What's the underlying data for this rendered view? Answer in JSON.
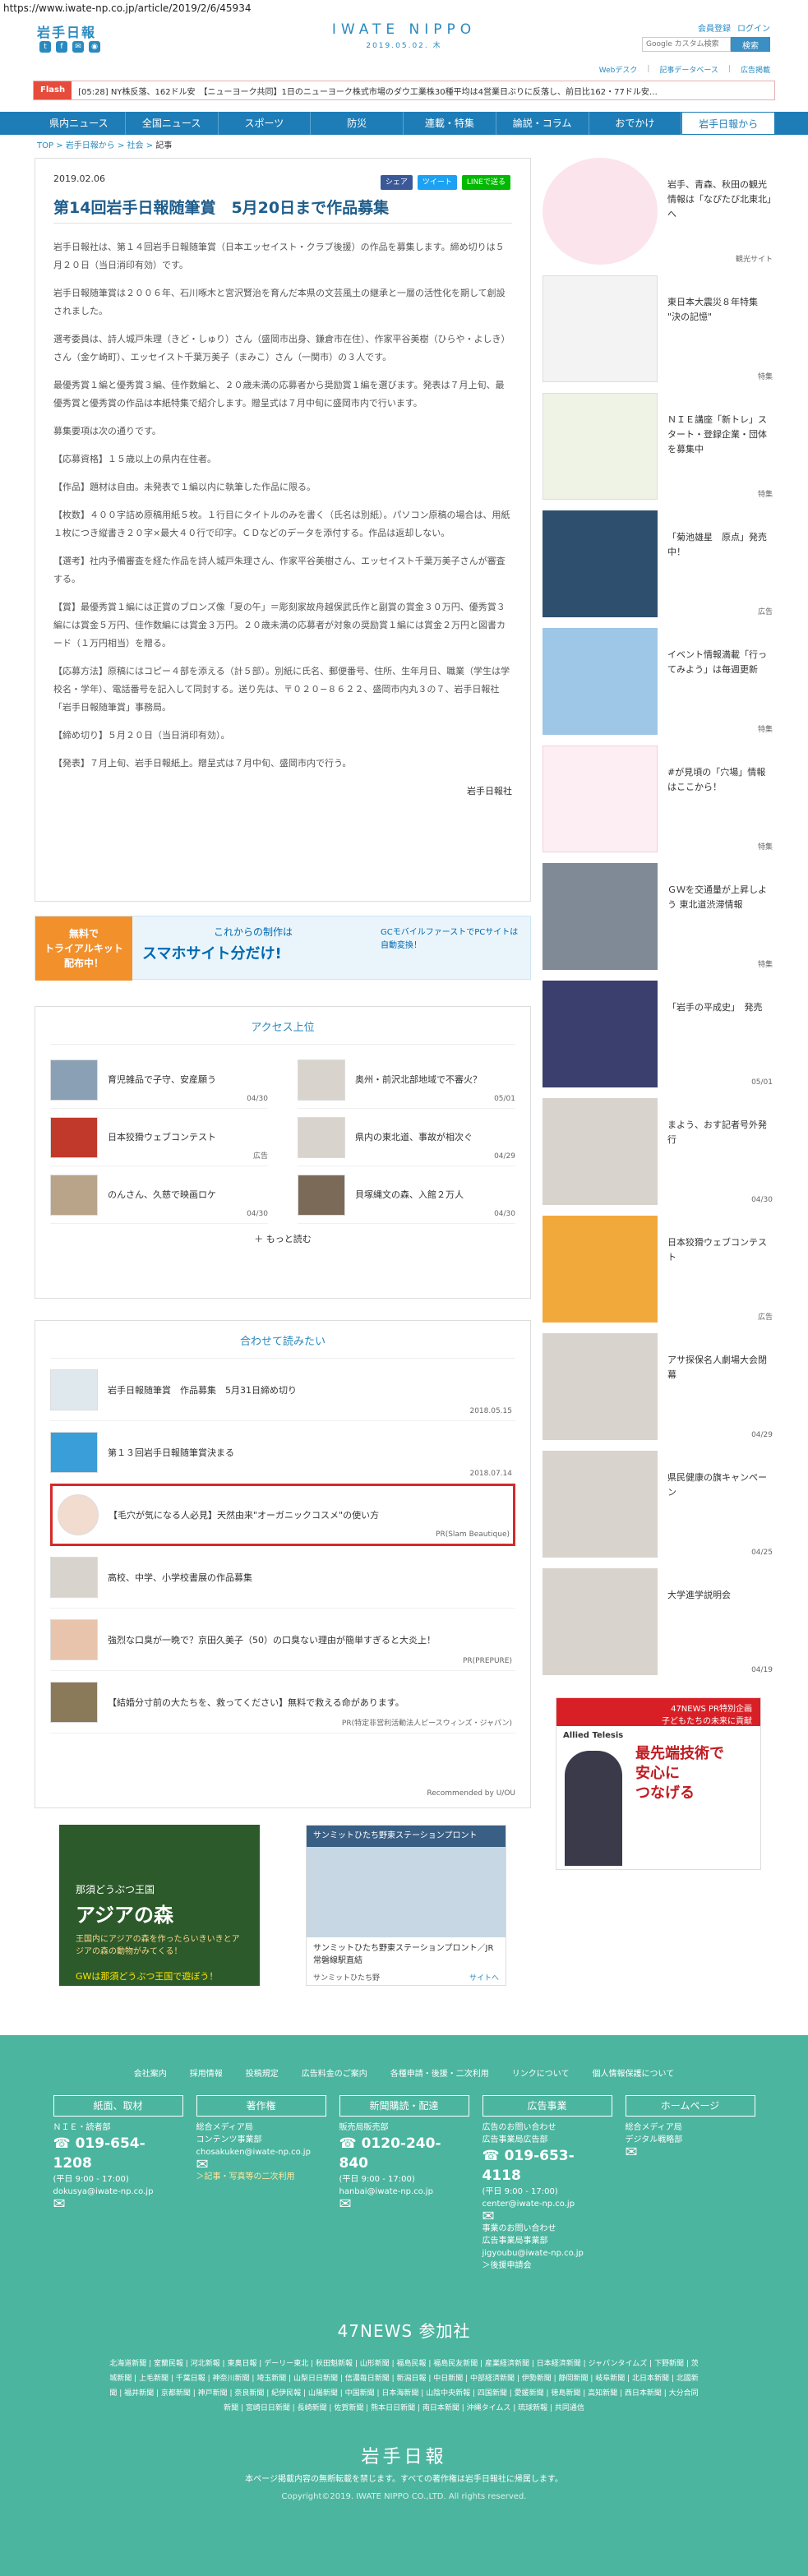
{
  "url": "https://www.iwate-np.co.jp/article/2019/2/6/45934",
  "header": {
    "brand": "岩手日報",
    "logo_main": "IWATE NIPPO",
    "logo_date": "2019.05.02. 木",
    "member_register": "会員登録",
    "login": "ログイン",
    "search_placeholder": "Google カスタム検索",
    "search_button": "検索"
  },
  "subnav": [
    "Webデスク",
    "記事データベース",
    "広告掲載"
  ],
  "flash": {
    "tag": "Flash",
    "text": "[05:28] NY株反落、162ドル安　【ニューヨーク共同】1日のニューヨーク株式市場のダウ工業株30種平均は4営業日ぶりに反落し、前日比162・77ドル安…"
  },
  "global_nav": [
    "県内ニュース",
    "全国ニュース",
    "スポーツ",
    "防災",
    "連載・特集",
    "論説・コラム",
    "おでかけ",
    "岩手日報から"
  ],
  "breadcrumb": [
    "TOP",
    "岩手日報から",
    "社会",
    "記事"
  ],
  "article": {
    "date": "2019.02.06",
    "share": [
      "シェア",
      "ツイート",
      "LINEで送る"
    ],
    "title": "第14回岩手日報随筆賞　5月20日まで作品募集",
    "paragraphs": [
      "岩手日報社は、第１４回岩手日報随筆賞（日本エッセイスト・クラブ後援）の作品を募集します。締め切りは５月２０日（当日消印有効）です。",
      "岩手日報随筆賞は２００６年、石川啄木と宮沢賢治を育んだ本県の文芸風土の継承と一層の活性化を期して創設されました。",
      "選考委員は、詩人城戸朱理（きど・しゅり）さん（盛岡市出身、鎌倉市在住）、作家平谷美樹（ひらや・よしき）さん（金ケ崎町）、エッセイスト千葉万美子（まみこ）さん（一関市）の３人です。",
      "最優秀賞１編と優秀賞３編、佳作数編と、２０歳未満の応募者から奨励賞１編を選びます。発表は７月上旬、最優秀賞と優秀賞の作品は本紙特集で紹介します。贈呈式は７月中旬に盛岡市内で行います。",
      "募集要項は次の通りです。",
      "【応募資格】１５歳以上の県内在住者。",
      "【作品】題材は自由。未発表で１編以内に執筆した作品に限る。",
      "【枚数】４００字詰め原稿用紙５枚。１行目にタイトルのみを書く（氏名は別紙）。パソコン原稿の場合は、用紙１枚につき縦書き２０字×最大４０行で印字。ＣＤなどのデータを添付する。作品は返却しない。",
      "【選考】社内予備審査を経た作品を詩人城戸朱理さん、作家平谷美樹さん、エッセイスト千葉万美子さんが審査する。",
      "【賞】最優秀賞１編には正賞のブロンズ像「夏の午」＝彫刻家故舟越保武氏作と副賞の賞金３０万円、優秀賞３編には賞金５万円、佳作数編には賞金３万円。２０歳未満の応募者が対象の奨励賞１編には賞金２万円と図書カード（１万円相当）を贈る。",
      "【応募方法】原稿にはコピー４部を添える（計５部）。別紙に氏名、郵便番号、住所、生年月日、職業（学生は学校名・学年）、電話番号を記入して同封する。送り先は、〒０２０−８６２２、盛岡市内丸３の７、岩手日報社「岩手日報随筆賞」事務局。",
      "【締め切り】５月２０日（当日消印有効）。",
      "【発表】７月上旬、岩手日報紙上。贈呈式は７月中旬、盛岡市内で行う。"
    ],
    "signature": "岩手日報社"
  },
  "ad_banner": {
    "left": "無料で\nトライアルキット\n配布中！",
    "sub": "これからの制作は",
    "main": "スマホサイト分だけ!",
    "right": "GCモバイルファーストでPCサイトは自動変換！"
  },
  "ranking": {
    "title": "アクセス上位",
    "items": [
      {
        "text": "育児雑品で子守、安産願う",
        "date": "04/30"
      },
      {
        "text": "奥州・前沢北部地域で不審火？",
        "date": "05/01"
      },
      {
        "text": "日本狡猾ウェブコンテスト",
        "date": "広告"
      },
      {
        "text": "県内の東北道、事故が相次ぐ",
        "date": "04/29"
      },
      {
        "text": "のんさん、久慈で映画ロケ",
        "date": "04/30"
      },
      {
        "text": "貝塚縄文の森、入館２万人",
        "date": "04/30"
      }
    ],
    "more": "もっと読む"
  },
  "recommend": {
    "title": "合わせて読みたい",
    "items": [
      {
        "text": "岩手日報随筆賞　作品募集　5月31日締め切り",
        "date": "2018.05.15"
      },
      {
        "text": "第１３回岩手日報随筆賞決まる",
        "date": "2018.07.14"
      },
      {
        "text": "【毛穴が気になる人必見】天然由来\"オーガニックコスメ\"の使い方",
        "date": "PR(Slam Beautique)"
      },
      {
        "text": "高校、中学、小学校書展の作品募集",
        "date": ""
      },
      {
        "text": "強烈な口臭が一晩で？京田久美子（50）の口臭ない理由が簡単すぎると大炎上！",
        "date": "PR(PREPURE)"
      },
      {
        "text": "【結婚分寸前の大たちを、救ってください】無料で救える命があります。",
        "date": "PR(特定非営利活動法人ピースウィンズ・ジャパン)"
      }
    ],
    "footer": "Recommended by U/OU"
  },
  "bottom_ads": {
    "ad1_a": "那須どうぶつ王国",
    "ad1_b": "アジアの森",
    "ad1_c": "王国内にアジアの森を作ったらいきいきとアジアの森の動物がみてくる！",
    "ad1_d": "GWは那須どうぶつ王国で遊ぼう！",
    "ad2_top": "サンミットひたち野東ステーションプロント",
    "ad2_cap": "サンミットひたち野東ステーションプロント／JR常磐線駅直結",
    "ad2_source": "サンミットひたち野",
    "ad2_link": "サイトへ"
  },
  "sidebar": [
    {
      "text": "岩手、青森、秋田の観光情報は「なぴたび北東北」へ",
      "tag": "観光サイト"
    },
    {
      "text": "東日本大震災８年特集 \"決の記憶\"",
      "tag": "特集"
    },
    {
      "text": "ＮＩＥ講座「新トレ」スタート・登録企業・団体を募集中",
      "tag": "特集"
    },
    {
      "text": "「菊池雄星　原点」発売中！",
      "tag": "広告"
    },
    {
      "text": "イベント情報満載「行ってみよう」は毎週更新",
      "tag": "特集"
    },
    {
      "text": "#が見頃の「穴場」情報はここから！",
      "tag": "特集"
    },
    {
      "text": "ＧＷを交通量が上昇しよう 東北道渋滞情報",
      "tag": "特集"
    },
    {
      "text": "「岩手の平成史」　発売",
      "tag": "05/01"
    },
    {
      "text": "まよう、おす記者号外発行",
      "tag": "04/30"
    },
    {
      "text": "日本狡猾ウェブコンテスト",
      "tag": "広告"
    },
    {
      "text": "アサ探保名人劇場大会閉幕",
      "tag": "04/29"
    },
    {
      "text": "県民健康の旗キャンペーン",
      "tag": "04/25"
    },
    {
      "text": "大学進学説明会",
      "tag": "04/19"
    }
  ],
  "side_ad": {
    "header": "47NEWS PR特別企画",
    "sub": "子どもたちの未来に貢献",
    "big": "最先端技術で\n安心に\nつなげる",
    "brand": "Allied Telesis"
  },
  "footer": {
    "links": [
      "会社案内",
      "採用情報",
      "投稿規定",
      "広告料金のご案内",
      "各種申請・後援・二次利用",
      "リンクについて",
      "個人情報保護について"
    ],
    "cols": [
      {
        "title": "紙面、取材",
        "sub": "ＮＩＥ・読者部",
        "tel": "019-654-1208",
        "hours": "(平日 9:00 - 17:00)",
        "mail": "dokusya@iwate-np.co.jp",
        "extra": ""
      },
      {
        "title": "著作権",
        "sub": "総合メディア局\nコンテンツ事業部",
        "tel": "",
        "hours": "",
        "mail": "chosakuken@iwate-np.co.jp",
        "extra": "＞記事・写真等の二次利用"
      },
      {
        "title": "新聞購読・配達",
        "sub": "販売局販売部",
        "tel": "0120-240-840",
        "hours": "(平日 9:00 - 17:00)",
        "mail": "hanbai@iwate-np.co.jp",
        "extra": ""
      },
      {
        "title": "広告事業",
        "sub": "広告のお問い合わせ\n広告事業局広告部",
        "tel": "019-653-4118",
        "hours": "(平日 9:00 - 17:00)",
        "mail": "center@iwate-np.co.jp",
        "extra": "事業のお問い合わせ\n広告事業局事業部\njigyoubu@iwate-np.co.jp\n＞後援申請会"
      },
      {
        "title": "ホームページ",
        "sub": "総合メディア局\nデジタル戦略部",
        "tel": "",
        "hours": "",
        "mail": "",
        "extra": ""
      }
    ],
    "news47": "47NEWS 参加社",
    "newslist": "北海道新聞 | 室蘭民報 | 河北新報 | 東奥日報 | デーリー東北 | 秋田魁新報 | 山形新聞 | 福島民報 | 福島民友新聞 | 産業経済新聞 | 日本経済新聞 | ジャパンタイムズ | 下野新聞 | 茨城新聞 | 上毛新聞 | 千葉日報 | 神奈川新聞 | 埼玉新聞 | 山梨日日新聞 | 信濃毎日新聞 | 新潟日報 | 中日新聞 | 中部経済新聞 | 伊勢新聞 | 静岡新聞 | 岐阜新聞 | 北日本新聞 | 北國新聞 | 福井新聞 | 京都新聞 | 神戸新聞 | 奈良新聞 | 紀伊民報 | 山陽新聞 | 中国新聞 | 日本海新聞 | 山陰中央新報 | 四国新聞 | 愛媛新聞 | 徳島新聞 | 高知新聞 | 西日本新聞 | 大分合同新聞 | 宮崎日日新聞 | 長崎新聞 | 佐賀新聞 | 熊本日日新聞 | 南日本新聞 | 沖縄タイムス | 琉球新報 | 共同通信",
    "brand": "岩手日報",
    "notice": "本ページ掲載内容の無断転載を禁じます。すべての著作権は岩手日報社に帰属します。",
    "copyright": "Copyright©2019. IWATE NIPPO CO.,LTD. All rights reserved."
  },
  "colors": {
    "accent": "#1e7db7",
    "footer": "#4cb59f",
    "highlight": "#d42b2b"
  }
}
